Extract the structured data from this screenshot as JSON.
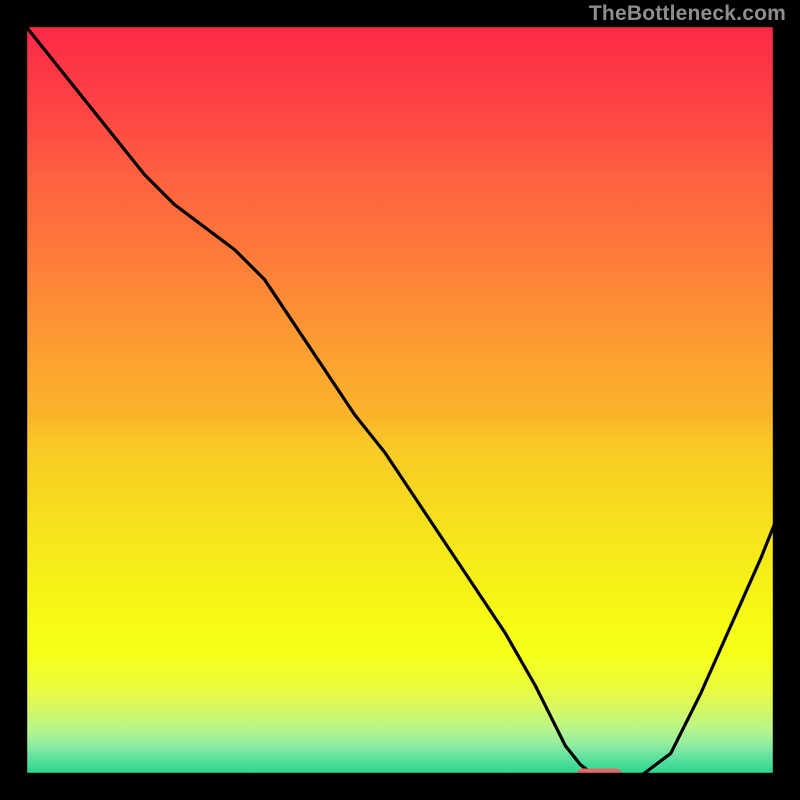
{
  "watermark": "TheBottleneck.com",
  "chart_data": {
    "type": "line",
    "title": "",
    "xlabel": "",
    "ylabel": "",
    "xlim": [
      0,
      100
    ],
    "ylim": [
      0,
      100
    ],
    "grid": false,
    "background": "vertical gradient red→orange→yellow→green",
    "series": [
      {
        "name": "bottleneck-curve",
        "x": [
          0,
          4,
          8,
          12,
          16,
          20,
          24,
          28,
          32,
          36,
          40,
          44,
          48,
          52,
          56,
          60,
          64,
          68,
          70,
          72,
          74,
          76,
          78,
          82,
          86,
          90,
          94,
          98,
          100
        ],
        "y": [
          100,
          95,
          90,
          85,
          80,
          76,
          73,
          70,
          66,
          60,
          54,
          48,
          43,
          37,
          31,
          25,
          19,
          12,
          8,
          4,
          1.5,
          0,
          0,
          0,
          3,
          11,
          20,
          29,
          34
        ]
      }
    ],
    "marker": {
      "name": "optimal-range-marker",
      "x_start": 73.5,
      "x_end": 79.5,
      "y": 0.2,
      "color": "#e26a6a"
    },
    "colors": {
      "curve": "#000000",
      "border": "#000000",
      "gradient_top": "#fd2846",
      "gradient_mid": "#f8e21d",
      "gradient_bottom": "#29d489",
      "marker": "#e26a6a"
    }
  }
}
